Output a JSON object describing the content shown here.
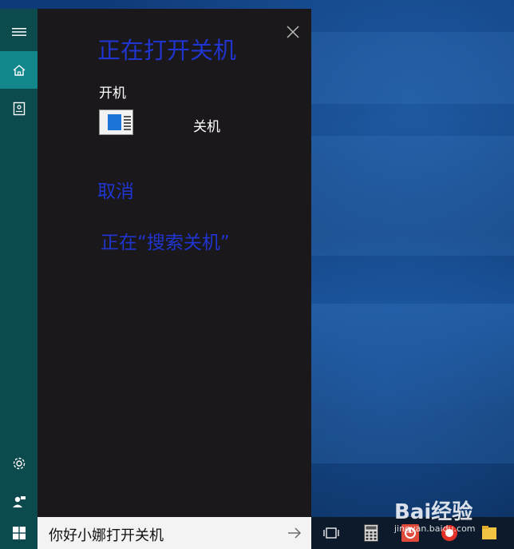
{
  "cortana": {
    "headline": "正在打开关机",
    "section_label": "开机",
    "result": {
      "name": "关机",
      "icon": "program-window-icon"
    },
    "cancel_label": "取消",
    "status_text": "正在“搜索关机”",
    "close_icon": "close-icon"
  },
  "rail": {
    "items": [
      {
        "icon": "hamburger-menu-icon",
        "active": false
      },
      {
        "icon": "home-icon",
        "active": true
      },
      {
        "icon": "notebook-icon",
        "active": false
      },
      {
        "icon": "gear-icon",
        "active": false
      },
      {
        "icon": "feedback-person-icon",
        "active": false
      }
    ]
  },
  "taskbar": {
    "start_icon": "windows-logo-icon",
    "search_value": "你好小娜打开关机",
    "search_submit_icon": "arrow-right-icon",
    "icons": [
      "task-view-icon",
      "calculator-icon",
      "app-icon-red",
      "app-icon-red-circle",
      "folder-icon"
    ]
  },
  "watermark": {
    "brand": "Bai经验",
    "url": "jingyan.baidu.com"
  },
  "colors": {
    "accent_blue": "#2035cf",
    "rail_teal": "#0d4a4e",
    "rail_active": "#11878c",
    "panel_bg": "#1a181b"
  }
}
